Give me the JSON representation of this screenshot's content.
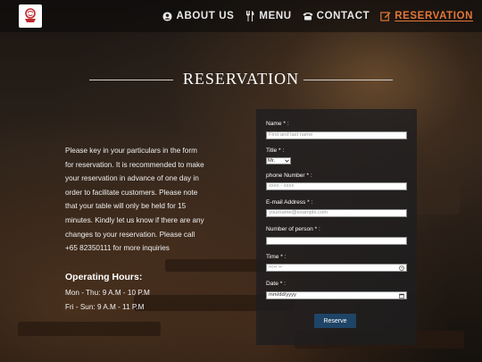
{
  "nav": {
    "logo_icon": "restaurant-logo-icon",
    "items": [
      {
        "label": "ABOUT US",
        "icon": "user-circle-icon"
      },
      {
        "label": "MENU",
        "icon": "utensils-icon"
      },
      {
        "label": "CONTACT",
        "icon": "phone-icon"
      },
      {
        "label": "RESERVATION",
        "icon": "edit-icon",
        "active": true
      }
    ],
    "active_color": "#e2763a"
  },
  "page": {
    "title": "RESERVATION",
    "intro_lines": [
      "Please key in your particulars in the form",
      "for reservation. It is recommended to make",
      "your reservation in advance of one day in",
      "order to facilitate customers. Please note",
      "that your table will only be held for 15",
      "minutes. Kindly let us know if there are any",
      "changes to your reservation. Please call",
      "+65 82350111 for more inquiries"
    ],
    "hours_title": "Operating Hours:",
    "hours": [
      "Mon - Thu: 9 A.M - 10 P.M",
      "Fri - Sun: 9 A.M - 11 P.M"
    ]
  },
  "form": {
    "name_label": "Name * :",
    "name_placeholder": "First and last name",
    "title_label": "Title * :",
    "title_value": "Mr.",
    "phone_label": "phone Number * :",
    "phone_placeholder": "xxxx - xxxx",
    "email_label": "E-mail Address * :",
    "email_placeholder": "yourname@example.com",
    "persons_label": "Number of person * :",
    "persons_value": "",
    "time_label": "Time * :",
    "time_placeholder": "--:-- --",
    "date_label": "Date * :",
    "date_placeholder": "mm/dd/yyyy",
    "submit_label": "Reserve",
    "button_color": "#1e4466"
  }
}
